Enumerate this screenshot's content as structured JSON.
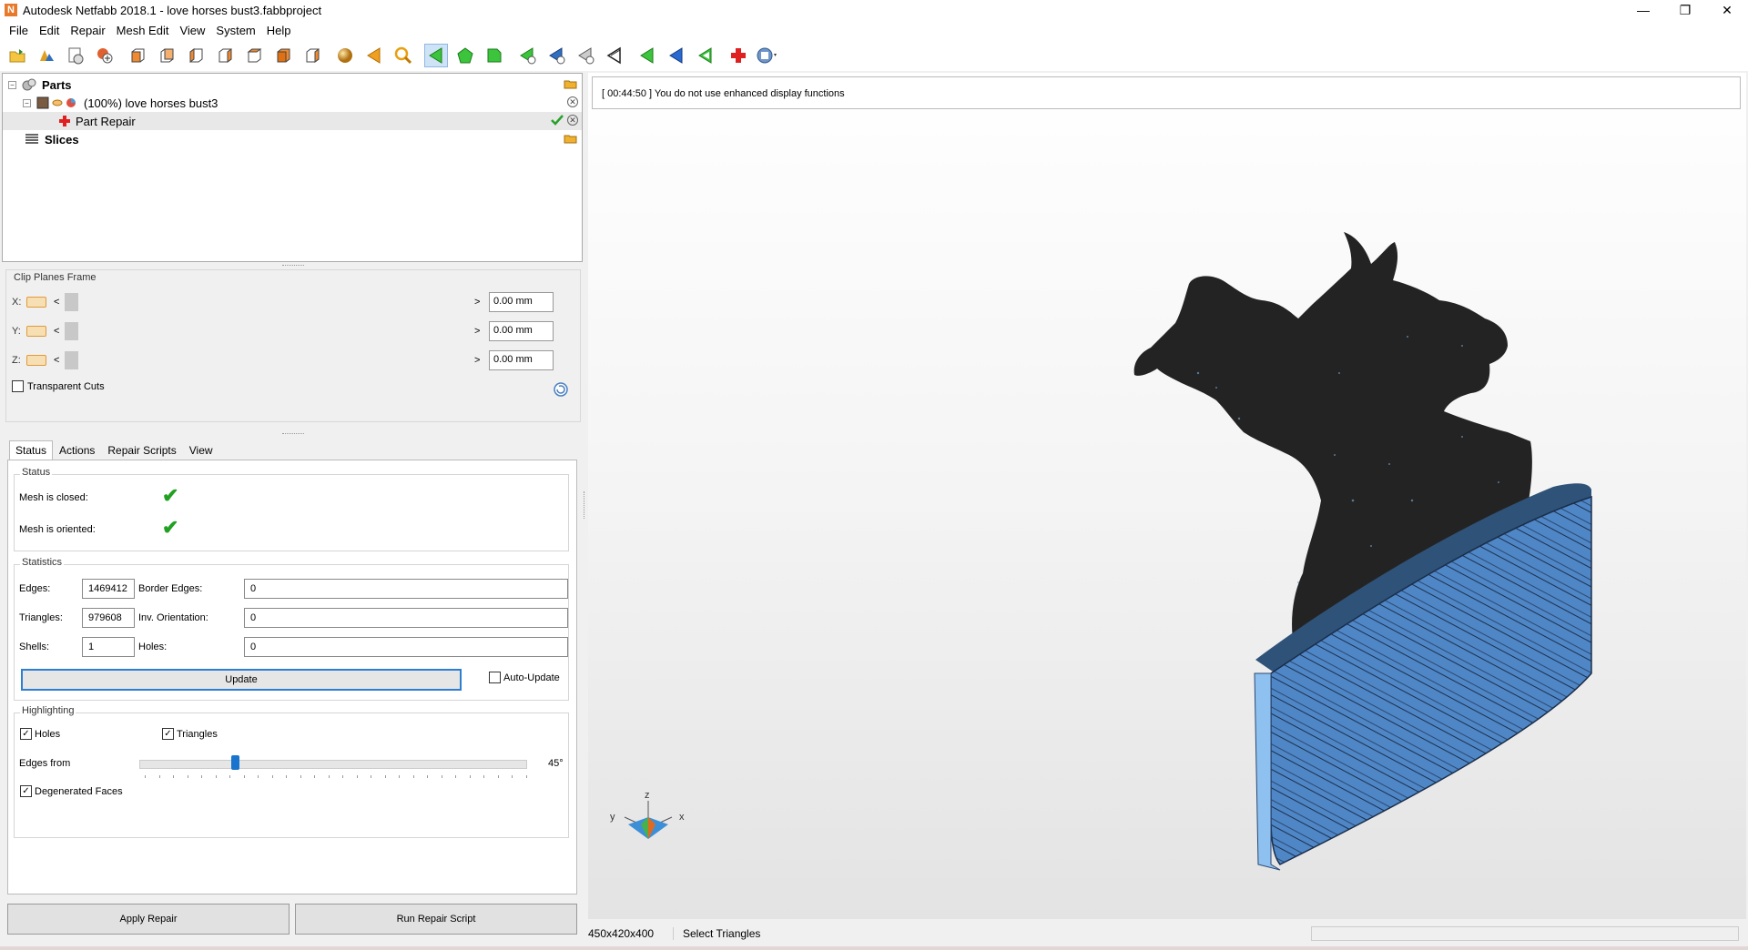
{
  "window": {
    "title": "Autodesk Netfabb 2018.1 - love horses bust3.fabbproject",
    "app_icon_letter": "N",
    "minimize_label": "—",
    "restore_label": "❐",
    "close_label": "✕"
  },
  "menubar": {
    "items": [
      "File",
      "Edit",
      "Repair",
      "Mesh Edit",
      "View",
      "System",
      "Help"
    ]
  },
  "toolbar": {
    "icons": [
      "open-project-icon",
      "add-part-icon",
      "new-project-icon",
      "add-objects-icon",
      "view-front-icon",
      "view-back-icon",
      "view-left-icon",
      "view-right-icon",
      "view-top-icon",
      "view-bottom-icon",
      "view-iso-icon",
      "shading-sphere-icon",
      "arrow-left-orange-icon",
      "zoom-icon",
      "select-triangles-icon",
      "select-shells-icon",
      "select-surfaces-icon",
      "add-triangle-icon",
      "remove-triangle-icon",
      "cut-triangle-icon",
      "flip-triangle-icon",
      "green-arrow-icon",
      "blue-arrow-icon",
      "green-arrow-outline-icon",
      "repair-cross-icon",
      "help-icon"
    ]
  },
  "tree": {
    "parts_label": "Parts",
    "part_label": "(100%) love horses bust3",
    "repair_label": "Part Repair",
    "slices_label": "Slices"
  },
  "clip_planes": {
    "title": "Clip Planes Frame",
    "rows": [
      {
        "axis": "X:",
        "value": "0.00 mm"
      },
      {
        "axis": "Y:",
        "value": "0.00 mm"
      },
      {
        "axis": "Z:",
        "value": "0.00 mm"
      }
    ],
    "transparent_cuts_label": "Transparent Cuts",
    "transparent_cuts_checked": false
  },
  "tabs": [
    "Status",
    "Actions",
    "Repair Scripts",
    "View"
  ],
  "active_tab": "Status",
  "status": {
    "group_label": "Status",
    "mesh_closed_label": "Mesh is closed:",
    "mesh_oriented_label": "Mesh is oriented:",
    "check_mark": "✔"
  },
  "statistics": {
    "group_label": "Statistics",
    "edges_label": "Edges:",
    "edges_value": "1469412",
    "border_edges_label": "Border Edges:",
    "border_edges_value": "0",
    "triangles_label": "Triangles:",
    "triangles_value": "979608",
    "inv_orientation_label": "Inv. Orientation:",
    "inv_orientation_value": "0",
    "shells_label": "Shells:",
    "shells_value": "1",
    "holes_label": "Holes:",
    "holes_value": "0",
    "update_label": "Update",
    "auto_update_label": "Auto-Update",
    "auto_update_checked": false
  },
  "highlighting": {
    "group_label": "Highlighting",
    "holes_label": "Holes",
    "triangles_label": "Triangles",
    "edges_from_label": "Edges from",
    "edges_from_value": "45°",
    "degenerated_label": "Degenerated Faces",
    "check_glyph": "✓"
  },
  "buttons": {
    "apply_repair": "Apply Repair",
    "run_repair_script": "Run Repair Script"
  },
  "viewport": {
    "log_message": "[ 00:44:50 ] You do not use enhanced display functions",
    "axis_z": "z",
    "axis_y": "y",
    "axis_x": "x",
    "colors": {
      "model_dark": "#232323",
      "base_blue": "#4f86c6",
      "base_light": "#8ec1ef"
    }
  },
  "statusbar": {
    "dimensions": "450x420x400",
    "mode": "Select Triangles"
  }
}
